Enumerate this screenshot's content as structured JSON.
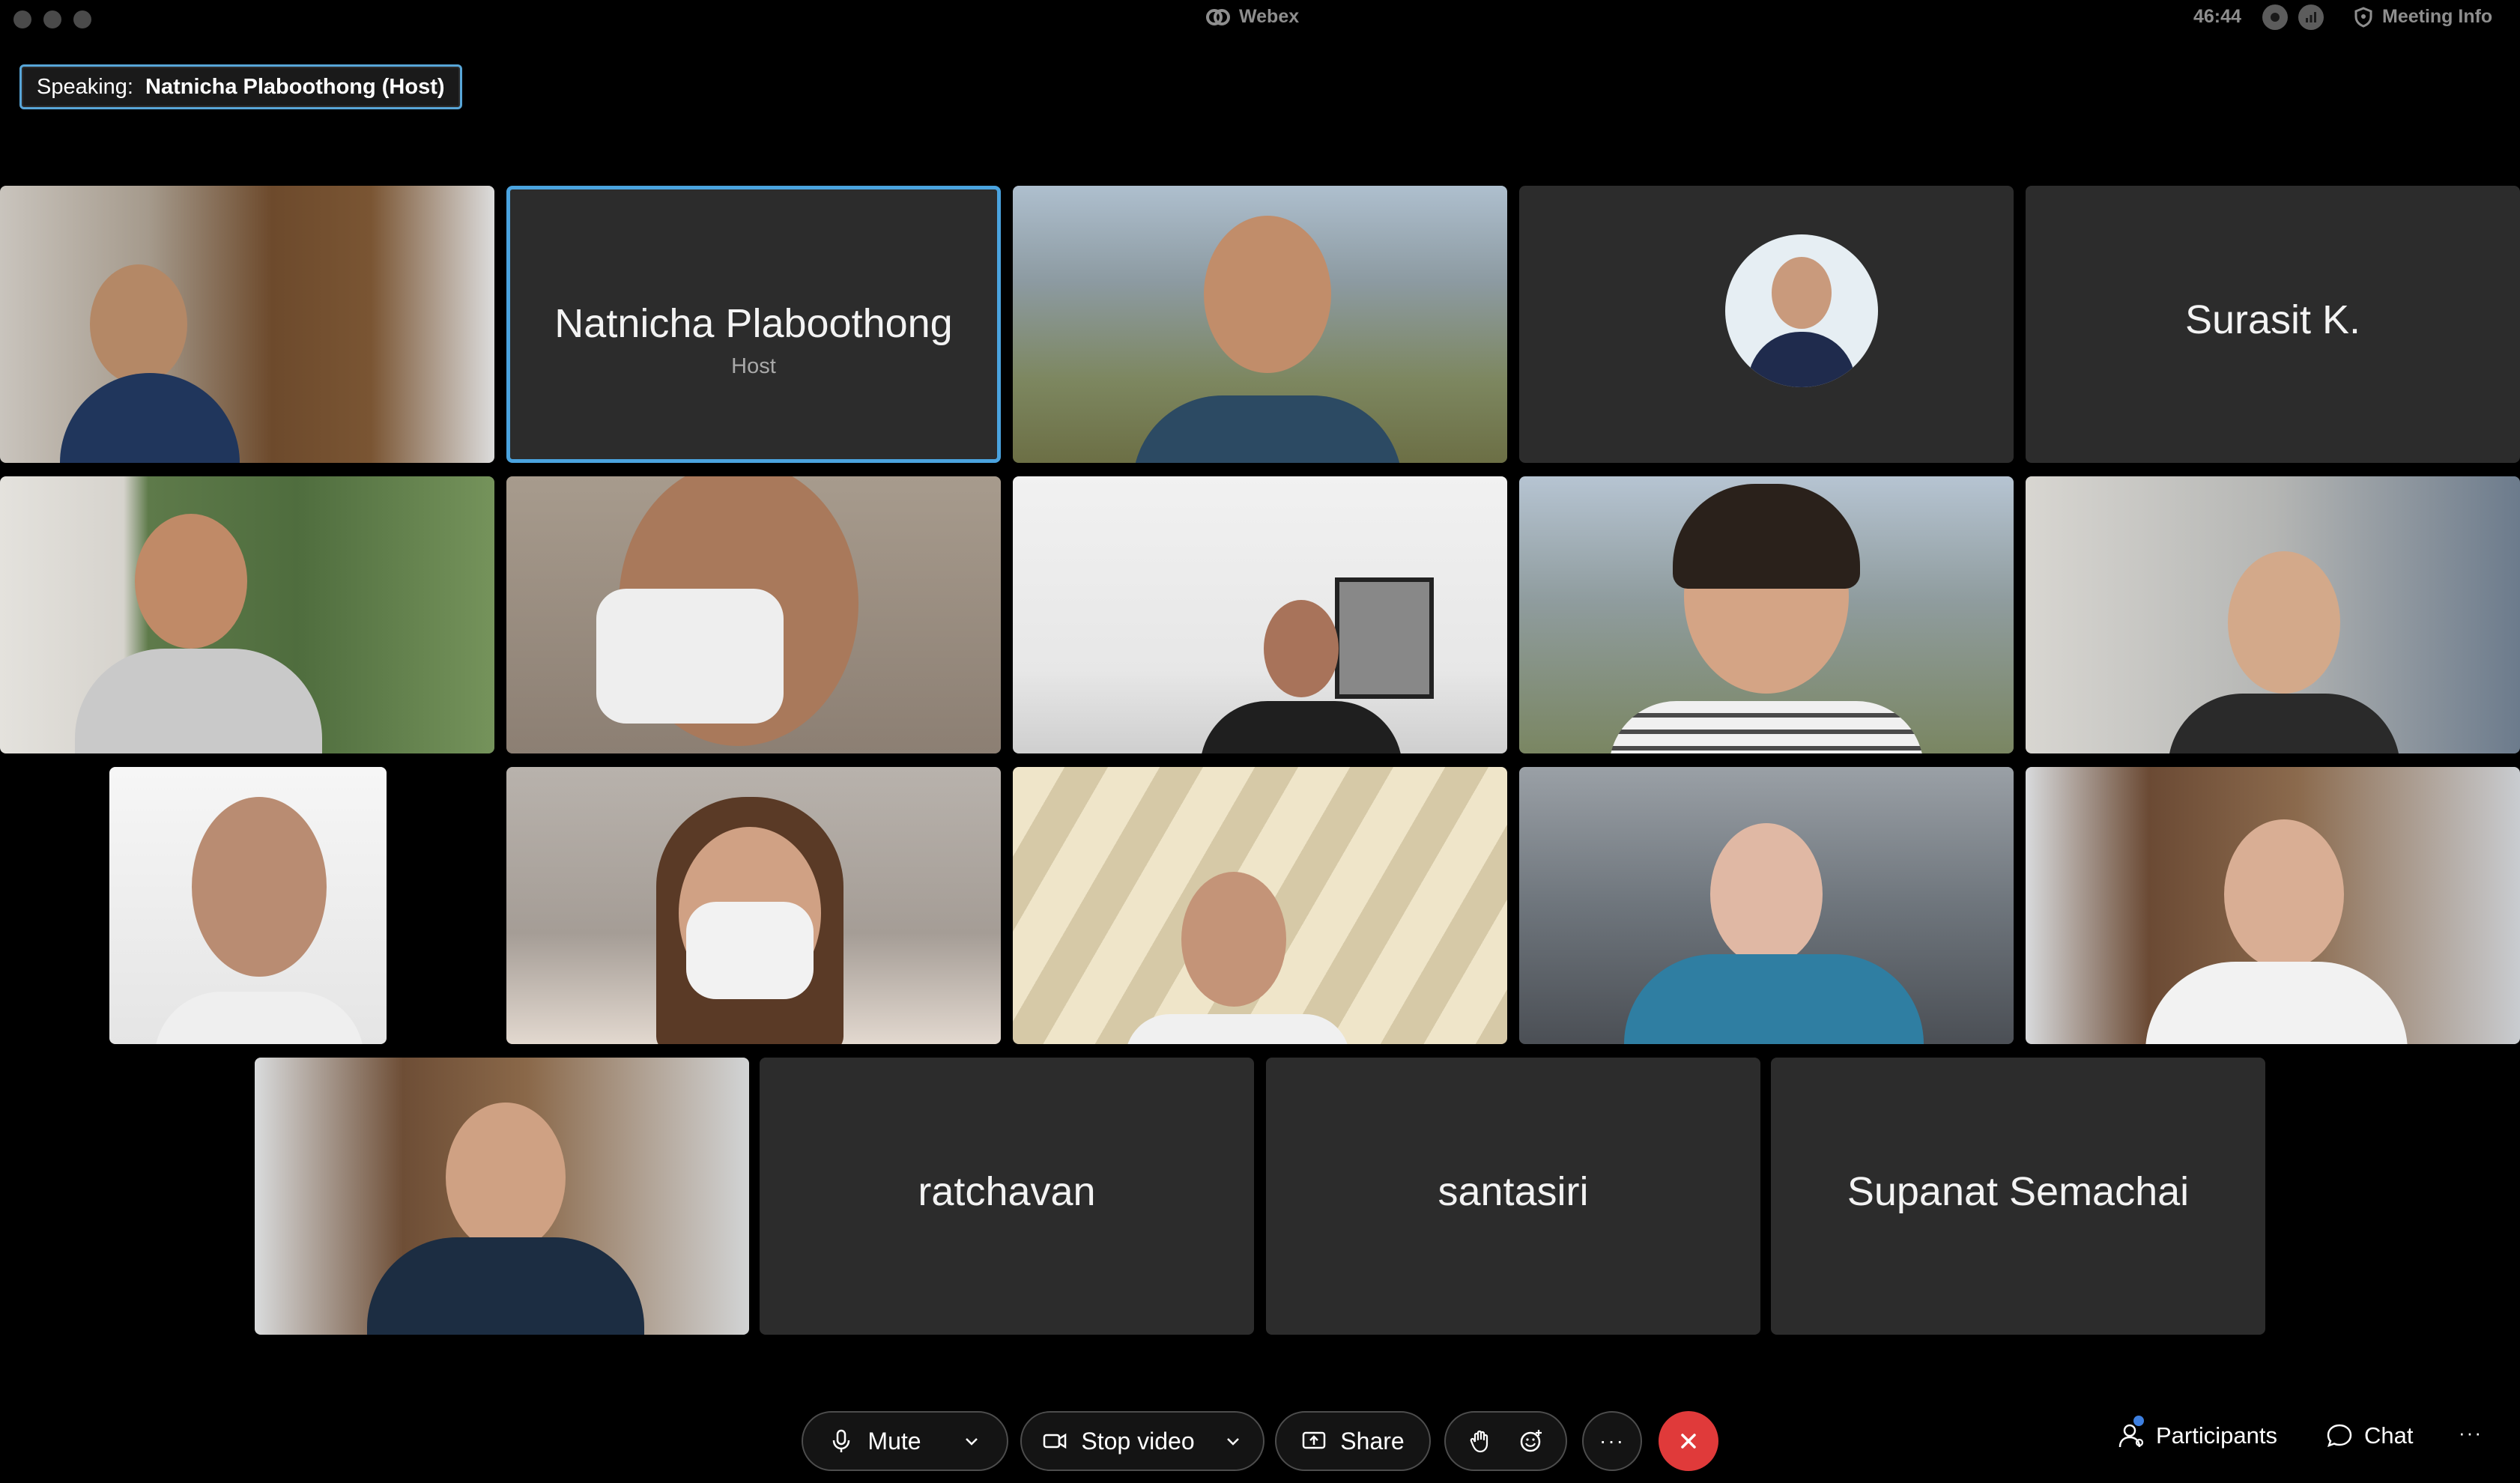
{
  "window": {
    "app_title": "Webex",
    "timer": "46:44",
    "meeting_info_label": "Meeting Info"
  },
  "speaking": {
    "prefix": "Speaking:",
    "name": "Natnicha Plaboothong (Host)"
  },
  "tiles": {
    "host": {
      "name": "Natnicha Plaboothong",
      "role": "Host"
    },
    "surasit": {
      "name": "Surasit K."
    },
    "ratchavan": {
      "name": "ratchavan"
    },
    "santasiri": {
      "name": "santasiri"
    },
    "supanat": {
      "name": "Supanat Semachai"
    }
  },
  "controls": {
    "mute_label": "Mute",
    "stop_video_label": "Stop video",
    "share_label": "Share",
    "more_label": "···",
    "participants_label": "Participants",
    "chat_label": "Chat",
    "overflow_label": "···"
  },
  "colors": {
    "accent": "#4aa3df",
    "end_call": "#e03a3a",
    "tile_bg": "#2c2c2c"
  }
}
